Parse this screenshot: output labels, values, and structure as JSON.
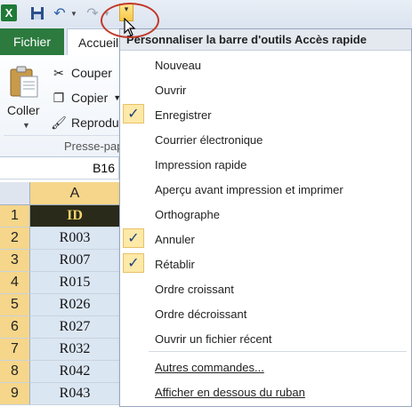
{
  "qat": {
    "icons": [
      "excel-icon",
      "save-icon",
      "undo-icon",
      "redo-icon",
      "customize-dropdown-icon"
    ]
  },
  "tabs": {
    "file": "Fichier",
    "home": "Accueil"
  },
  "ribbon": {
    "paste_label": "Coller",
    "cut_label": "Couper",
    "copy_label": "Copier",
    "painter_label": "Reproduire",
    "group_label": "Presse-papiers"
  },
  "formula_bar": {
    "name_box": "B16"
  },
  "sheet": {
    "column_a": "A",
    "rows": [
      {
        "num": "1",
        "value": "ID"
      },
      {
        "num": "2",
        "value": "R003"
      },
      {
        "num": "3",
        "value": "R007"
      },
      {
        "num": "4",
        "value": "R015"
      },
      {
        "num": "5",
        "value": "R026"
      },
      {
        "num": "6",
        "value": "R027"
      },
      {
        "num": "7",
        "value": "R032"
      },
      {
        "num": "8",
        "value": "R042"
      },
      {
        "num": "9",
        "value": "R043"
      }
    ]
  },
  "menu": {
    "title": "Personnaliser la barre d'outils Accès rapide",
    "items": [
      {
        "label": "Nouveau",
        "checked": false
      },
      {
        "label": "Ouvrir",
        "checked": false
      },
      {
        "label": "Enregistrer",
        "checked": true
      },
      {
        "label": "Courrier électronique",
        "checked": false
      },
      {
        "label": "Impression rapide",
        "checked": false
      },
      {
        "label": "Aperçu avant impression et imprimer",
        "checked": false
      },
      {
        "label": "Orthographe",
        "checked": false
      },
      {
        "label": "Annuler",
        "checked": true
      },
      {
        "label": "Rétablir",
        "checked": true
      },
      {
        "label": "Ordre croissant",
        "checked": false
      },
      {
        "label": "Ordre décroissant",
        "checked": false
      },
      {
        "label": "Ouvrir un fichier récent",
        "checked": false
      }
    ],
    "more_commands": "Autres commandes...",
    "show_below": "Afficher en dessous du ruban"
  },
  "colors": {
    "file_tab": "#2c7a3e",
    "header_highlight": "#f5d68a",
    "check_bg": "#fde9a8",
    "annotation_circle": "#c0392b"
  }
}
